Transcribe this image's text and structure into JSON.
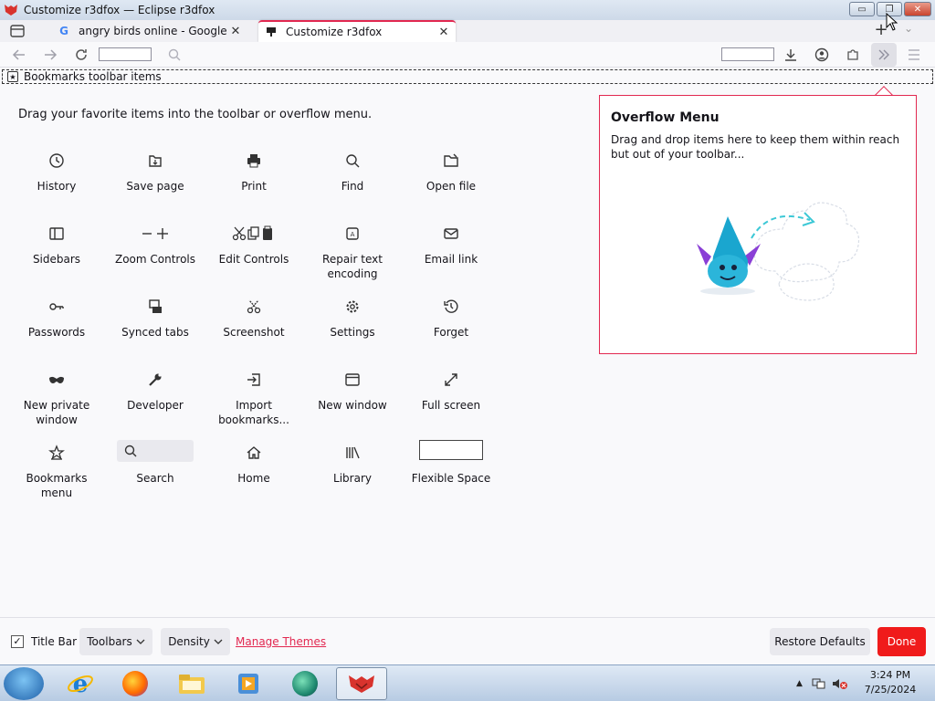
{
  "window": {
    "title": "Customize r3dfox — Eclipse r3dfox",
    "minimize": "▭",
    "restore": "❐",
    "close": "✕"
  },
  "tabs": [
    {
      "label": "angry birds online - Google Search",
      "icon": "google-icon",
      "close": "✕"
    },
    {
      "label": "Customize r3dfox",
      "icon": "puzzle-icon",
      "close": "✕"
    }
  ],
  "tabstrip": {
    "new_tab": "+",
    "all_tabs": "⌄"
  },
  "bookmarks_toolbar": {
    "label": "Bookmarks toolbar items"
  },
  "main": {
    "instructions": "Drag your favorite items into the toolbar or overflow menu.",
    "items": [
      {
        "label": "History",
        "icon": "clock-icon"
      },
      {
        "label": "Save page",
        "icon": "save-page-icon"
      },
      {
        "label": "Print",
        "icon": "printer-icon"
      },
      {
        "label": "Find",
        "icon": "magnifier-icon"
      },
      {
        "label": "Open file",
        "icon": "open-file-icon"
      },
      {
        "label": "Sidebars",
        "icon": "sidebar-icon"
      },
      {
        "label": "Zoom Controls",
        "icon": "zoom-icon"
      },
      {
        "label": "Edit Controls",
        "icon": "edit-controls-icon"
      },
      {
        "label": "Repair text encoding",
        "icon": "text-encoding-icon"
      },
      {
        "label": "Email link",
        "icon": "envelope-icon"
      },
      {
        "label": "Passwords",
        "icon": "key-icon"
      },
      {
        "label": "Synced tabs",
        "icon": "synced-tabs-icon"
      },
      {
        "label": "Screenshot",
        "icon": "scissors-icon"
      },
      {
        "label": "Settings",
        "icon": "gear-icon"
      },
      {
        "label": "Forget",
        "icon": "forget-icon"
      },
      {
        "label": "New private window",
        "icon": "mask-icon"
      },
      {
        "label": "Developer",
        "icon": "wrench-icon"
      },
      {
        "label": "Import bookmarks...",
        "icon": "import-icon"
      },
      {
        "label": "New window",
        "icon": "window-icon"
      },
      {
        "label": "Full screen",
        "icon": "fullscreen-icon"
      },
      {
        "label": "Bookmarks menu",
        "icon": "star-icon"
      },
      {
        "label": "Search",
        "icon": "search-icon"
      },
      {
        "label": "Home",
        "icon": "home-icon"
      },
      {
        "label": "Library",
        "icon": "library-icon"
      },
      {
        "label": "Flexible Space",
        "icon": "flexible-space"
      }
    ]
  },
  "overflow": {
    "title": "Overflow Menu",
    "description": "Drag and drop items here to keep them within reach but out of your toolbar..."
  },
  "footer": {
    "title_bar_label": "Title Bar",
    "title_bar_checked": true,
    "toolbars_label": "Toolbars",
    "density_label": "Density",
    "manage_themes": "Manage Themes",
    "restore_defaults": "Restore Defaults",
    "done": "Done"
  },
  "taskbar": {
    "time": "3:24 PM",
    "date": "7/25/2024",
    "apps": [
      "internet-explorer-icon",
      "firefox-icon",
      "file-explorer-icon",
      "media-player-icon",
      "app-icon",
      "r3dfox-icon"
    ]
  },
  "colors": {
    "accent": "#e22850",
    "done": "#f01b1b",
    "link": "#e22850"
  }
}
